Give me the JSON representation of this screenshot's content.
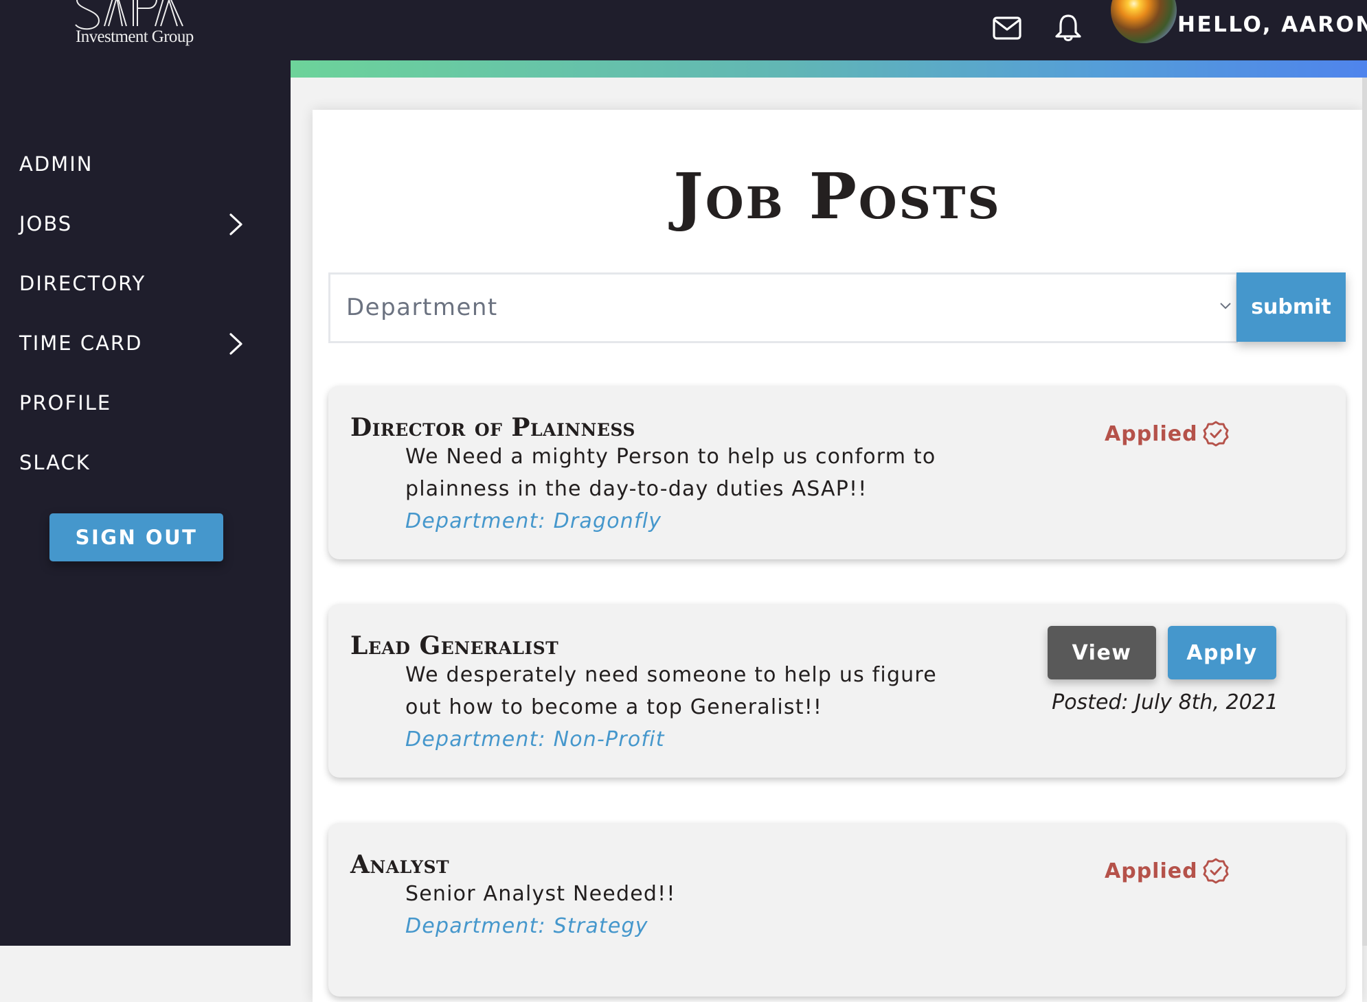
{
  "brand": {
    "logo_text": "SAPA",
    "logo_subtitle": "Investment Group"
  },
  "sidebar": {
    "items": [
      {
        "label": "ADMIN",
        "has_submenu": false
      },
      {
        "label": "JOBS",
        "has_submenu": true
      },
      {
        "label": "DIRECTORY",
        "has_submenu": false
      },
      {
        "label": "TIME CARD",
        "has_submenu": true
      },
      {
        "label": "PROFILE",
        "has_submenu": false
      },
      {
        "label": "SLACK",
        "has_submenu": false
      }
    ],
    "sign_out_label": "SIGN OUT"
  },
  "header": {
    "icons": [
      "mail-icon",
      "bell-icon"
    ],
    "greeting": "HELLO, AARON!"
  },
  "main": {
    "title": "Job Posts",
    "filter": {
      "placeholder": "Department",
      "submit_label": "submit"
    },
    "jobs": [
      {
        "title": "Director of Plainness",
        "description": "We Need a mighty Person to help us conform to plainness in the day-to-day duties ASAP!!",
        "department": "Department: Dragonfly",
        "status": "Applied"
      },
      {
        "title": "Lead Generalist",
        "description": "We desperately need someone to help us figure out how to become a top Generalist!!",
        "department": "Department: Non-Profit",
        "view_label": "View",
        "apply_label": "Apply",
        "posted": "Posted: July 8th, 2021"
      },
      {
        "title": "Analyst",
        "description": "Senior Analyst Needed!!",
        "department": "Department: Strategy",
        "status": "Applied"
      }
    ]
  },
  "colors": {
    "sidebar_bg": "#1f1e2c",
    "accent_blue": "#4597cc",
    "applied_red": "#b5524a",
    "view_gray": "#595959",
    "card_bg": "#f2f2f2"
  }
}
